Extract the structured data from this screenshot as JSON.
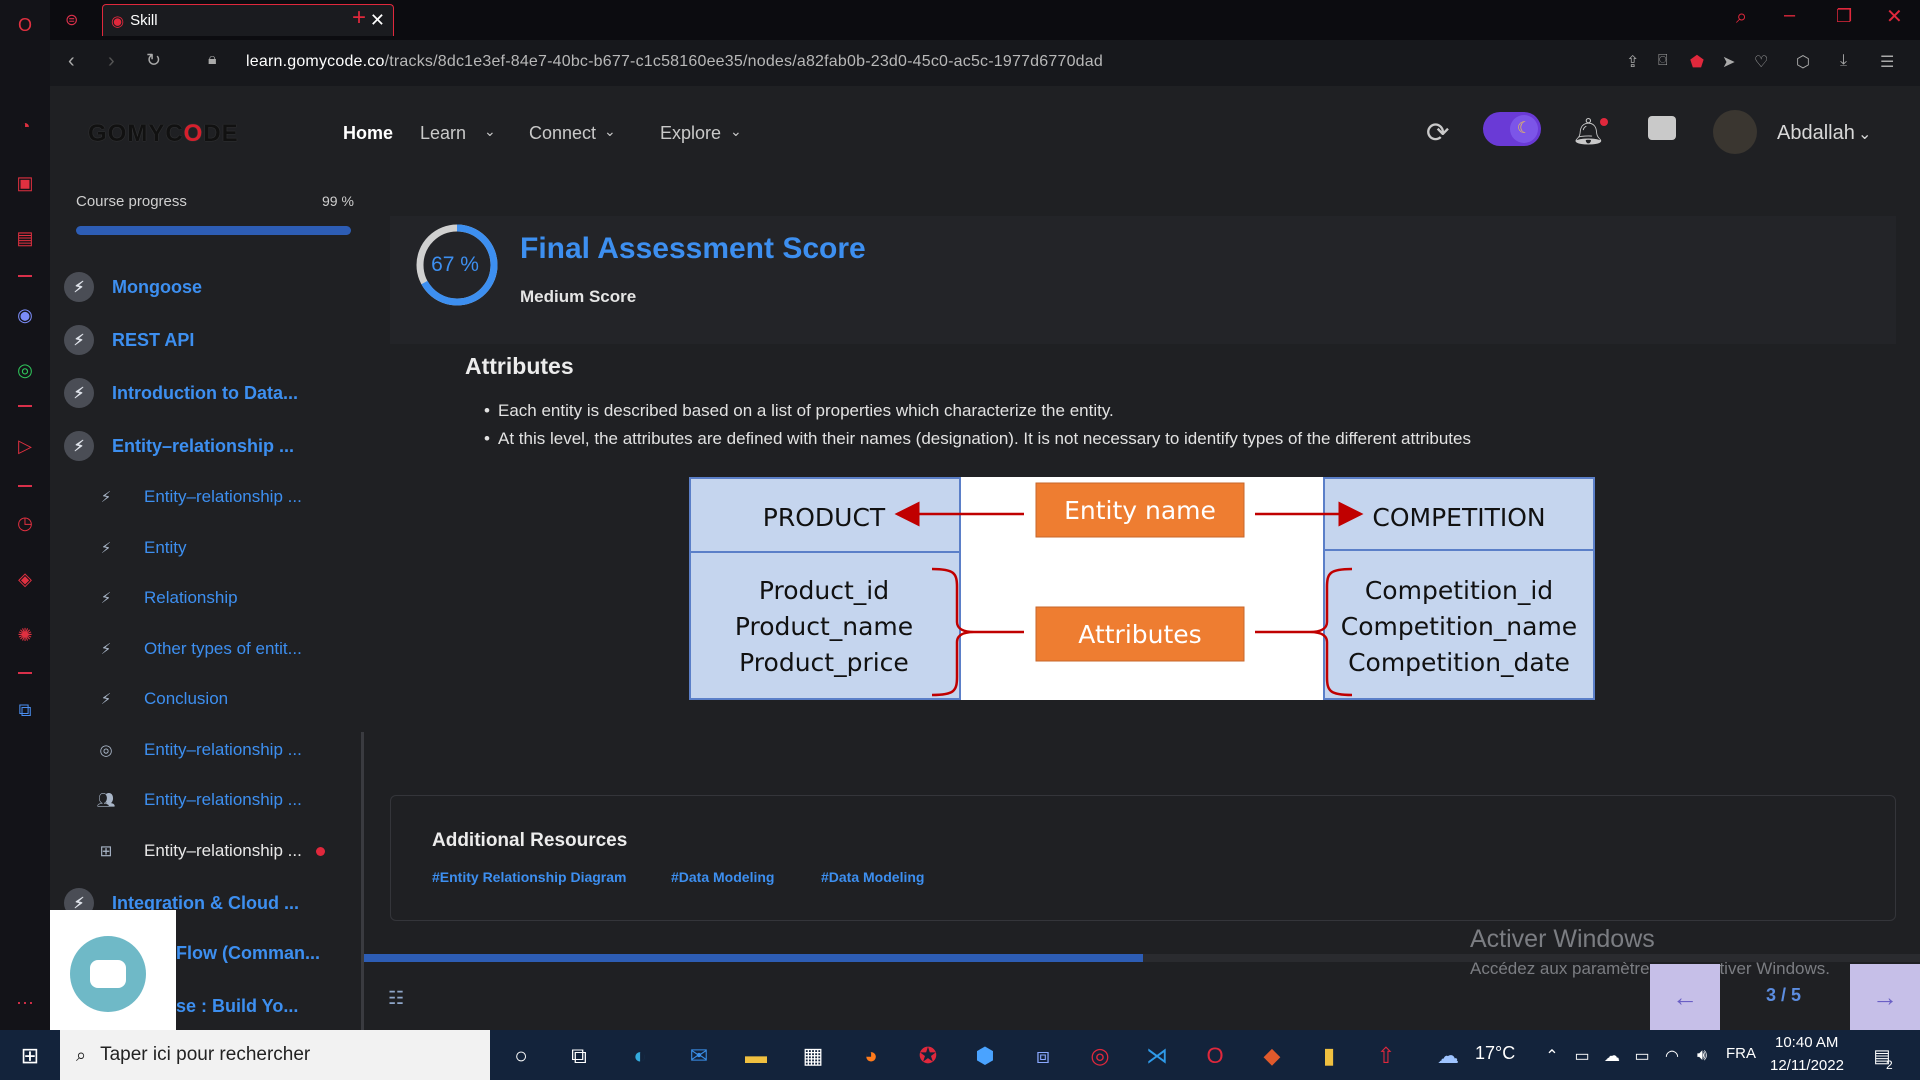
{
  "browser": {
    "tab_title": "Skill",
    "url_host": "learn.gomycode.co",
    "url_path": "/tracks/8dc1e3ef-84e7-40bc-b677-c1c58160ee35/nodes/a82fab0b-23d0-45c0-ac5c-1977d6770dad"
  },
  "header": {
    "logo_left": "GOMYC",
    "logo_mid": "O",
    "logo_right": "DE",
    "nav": [
      "Home",
      "Learn",
      "Connect",
      "Explore"
    ],
    "username": "Abdallah"
  },
  "sidebar": {
    "progress_label": "Course progress",
    "progress_pct": "99 %",
    "progress_value": 0.99,
    "courses": [
      {
        "label": "Mongoose"
      },
      {
        "label": "REST API"
      },
      {
        "label": "Introduction to Data..."
      },
      {
        "label": "Entity–relationship ..."
      }
    ],
    "subitems": [
      {
        "label": "Entity–relationship ...",
        "icon": "bolt-icon"
      },
      {
        "label": "Entity",
        "icon": "bolt-icon"
      },
      {
        "label": "Relationship",
        "icon": "bolt-icon"
      },
      {
        "label": "Other types of entit...",
        "icon": "bolt-icon"
      },
      {
        "label": "Conclusion",
        "icon": "bolt-icon"
      },
      {
        "label": "Entity–relationship ...",
        "icon": "target-icon"
      },
      {
        "label": "Entity–relationship ...",
        "icon": "people-icon"
      },
      {
        "label": "Entity–relationship ...",
        "icon": "board-icon"
      }
    ],
    "courses_after": [
      {
        "label": "Integration & Cloud ..."
      },
      {
        "label": "Flow (Comman..."
      },
      {
        "label": "se : Build Yo..."
      }
    ]
  },
  "score": {
    "percent_text": "67 %",
    "percent_value": 0.67,
    "title": "Final Assessment Score",
    "subtitle": "Medium Score"
  },
  "content": {
    "section_title": "Attributes",
    "bullets": [
      "Each entity is described based on a list of properties which characterize the entity.",
      "At this level, the attributes are defined with their names (designation). It is not necessary to identify types of the different attributes"
    ],
    "diagram": {
      "left_entity": "PRODUCT",
      "right_entity": "COMPETITION",
      "entity_label": "Entity name",
      "attributes_label": "Attributes",
      "left_attributes": [
        "Product_id",
        "Product_name",
        "Product_price"
      ],
      "right_attributes": [
        "Competition_id",
        "Competition_name",
        "Competition_date"
      ]
    }
  },
  "resources": {
    "title": "Additional Resources",
    "tags": [
      "#Entity Relationship Diagram",
      "#Data Modeling",
      "#Data Modeling"
    ]
  },
  "pager": {
    "count": "3 / 5",
    "progress_value": 0.5
  },
  "windows_activation": {
    "title": "Activer Windows",
    "subtitle": "Accédez aux paramètres pour activer Windows."
  },
  "taskbar": {
    "search_placeholder": "Taper ici pour rechercher",
    "weather": "17°C",
    "lang": "FRA",
    "time": "10:40 AM",
    "date": "12/11/2022",
    "notification_count": "2"
  },
  "colors": {
    "accent": "#3d8ff0",
    "brand_red": "#d61f2c",
    "diagram_fill": "#c5d5ee",
    "diagram_orange": "#ee7d31",
    "diagram_red": "#c00000"
  }
}
